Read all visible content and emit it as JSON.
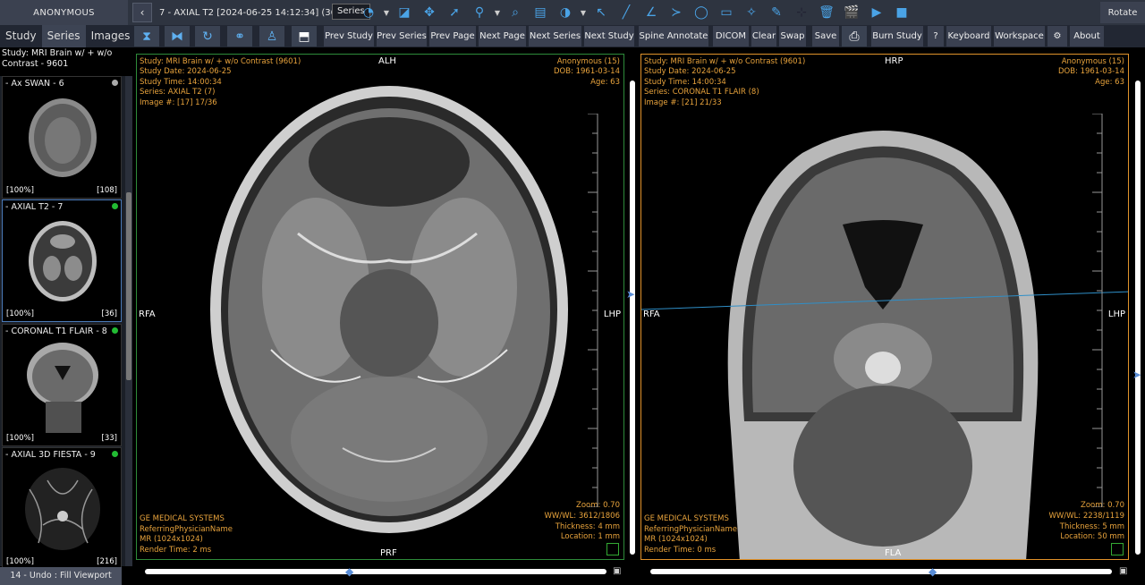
{
  "topbar": {
    "patient": "ANONYMOUS",
    "back": "‹",
    "series_title": "7 - AXIAL T2 [2024-06-25 14:12:34] (36)",
    "tooltip": "Series",
    "rotate_label": "Rotate"
  },
  "tabs": {
    "study": "Study",
    "series": "Series",
    "images": "Images"
  },
  "buttons": {
    "prev_study": "Prev Study",
    "prev_series": "Prev Series",
    "prev_page": "Prev Page",
    "next_page": "Next Page",
    "next_series": "Next Series",
    "next_study": "Next Study",
    "spine_annotate": "Spine Annotate",
    "dicom": "DICOM",
    "clear": "Clear",
    "swap": "Swap",
    "save": "Save",
    "burn_study": "Burn Study",
    "help": "?",
    "keyboard": "Keyboard",
    "workspace": "Workspace",
    "about": "About"
  },
  "sidebar": {
    "study_label": "Study: MRI Brain w/ + w/o Contrast - 9601",
    "thumbs": [
      {
        "name": "- Ax SWAN - 6",
        "pct": "[100%]",
        "count": "[108]",
        "dot": "#aaaaaa"
      },
      {
        "name": "- AXIAL T2 - 7",
        "pct": "[100%]",
        "count": "[36]",
        "dot": "#22bb33"
      },
      {
        "name": "- CORONAL T1 FLAIR - 8",
        "pct": "[100%]",
        "count": "[33]",
        "dot": "#22bb33"
      },
      {
        "name": "- AXIAL 3D FIESTA - 9",
        "pct": "[100%]",
        "count": "[216]",
        "dot": "#22bb33"
      }
    ],
    "undo": "14 - Undo : Fill Viewport"
  },
  "viewport_left": {
    "study": "Study: MRI Brain w/ + w/o Contrast (9601)",
    "date": "Study Date: 2024-06-25",
    "time": "Study Time: 14:00:34",
    "series": "Series: AXIAL T2 (7)",
    "image": "Image #: [17] 17/36",
    "patient": "Anonymous (15)",
    "dob": "DOB: 1961-03-14",
    "age": "Age: 63",
    "zoom": "Zoom: 0.70",
    "wwwl": "WW/WL: 3612/1806",
    "thickness": "Thickness: 4 mm",
    "location": "Location: 1 mm",
    "maker": "GE MEDICAL SYSTEMS",
    "physician": "ReferringPhysicianName",
    "modality": "MR (1024x1024)",
    "render": "Render Time: 2 ms",
    "top": "ALH",
    "left": "RFA",
    "right": "LHP",
    "bottom": "PRF"
  },
  "viewport_right": {
    "study": "Study: MRI Brain w/ + w/o Contrast (9601)",
    "date": "Study Date: 2024-06-25",
    "time": "Study Time: 14:00:34",
    "series": "Series: CORONAL T1 FLAIR (8)",
    "image": "Image #: [21] 21/33",
    "patient": "Anonymous (15)",
    "dob": "DOB: 1961-03-14",
    "age": "Age: 63",
    "zoom": "Zoom: 0.70",
    "wwwl": "WW/WL: 2238/1119",
    "thickness": "Thickness: 5 mm",
    "location": "Location: 50 mm",
    "maker": "GE MEDICAL SYSTEMS",
    "physician": "ReferringPhysicianName",
    "modality": "MR (1024x1024)",
    "render": "Render Time: 0 ms",
    "top": "HRP",
    "left": "RFA",
    "right": "LHP",
    "bottom": "FLA"
  },
  "colors": {
    "left_border": "#2e8b3a",
    "right_border": "#e0922a",
    "overlay": "#e8a33c",
    "accent": "#4aa3e6"
  }
}
